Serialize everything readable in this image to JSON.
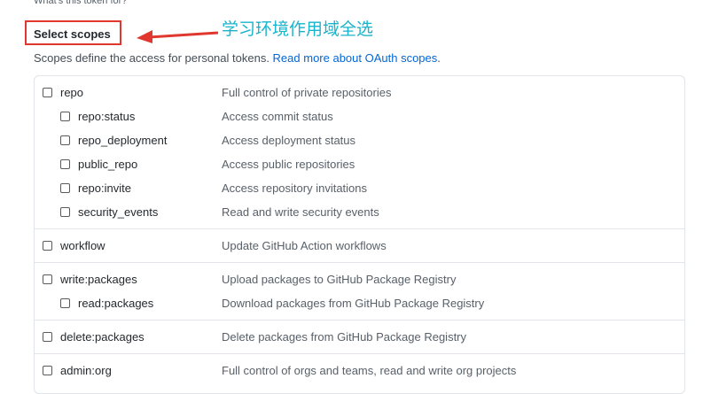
{
  "page": {
    "top_text": "What's this token for?",
    "heading": "Select scopes",
    "annotation": "学习环境作用域全选",
    "description": "Scopes define the access for personal tokens. ",
    "description_link": "Read more about OAuth scopes",
    "description_end": "."
  },
  "scopes": [
    {
      "name": "repo",
      "desc": "Full control of private repositories",
      "checked": false
    },
    {
      "name": "repo:status",
      "desc": "Access commit status",
      "checked": false
    },
    {
      "name": "repo_deployment",
      "desc": "Access deployment status",
      "checked": false
    },
    {
      "name": "public_repo",
      "desc": "Access public repositories",
      "checked": false
    },
    {
      "name": "repo:invite",
      "desc": "Access repository invitations",
      "checked": false
    },
    {
      "name": "security_events",
      "desc": "Read and write security events",
      "checked": false
    },
    {
      "name": "workflow",
      "desc": "Update GitHub Action workflows",
      "checked": false
    },
    {
      "name": "write:packages",
      "desc": "Upload packages to GitHub Package Registry",
      "checked": false
    },
    {
      "name": "read:packages",
      "desc": "Download packages from GitHub Package Registry",
      "checked": false
    },
    {
      "name": "delete:packages",
      "desc": "Delete packages from GitHub Package Registry",
      "checked": false
    },
    {
      "name": "admin:org",
      "desc": "Full control of orgs and teams, read and write org projects",
      "checked": false
    }
  ],
  "colors": {
    "link": "#0366d6",
    "annotation": "#18b4cc",
    "highlight_box": "#e0382f"
  }
}
